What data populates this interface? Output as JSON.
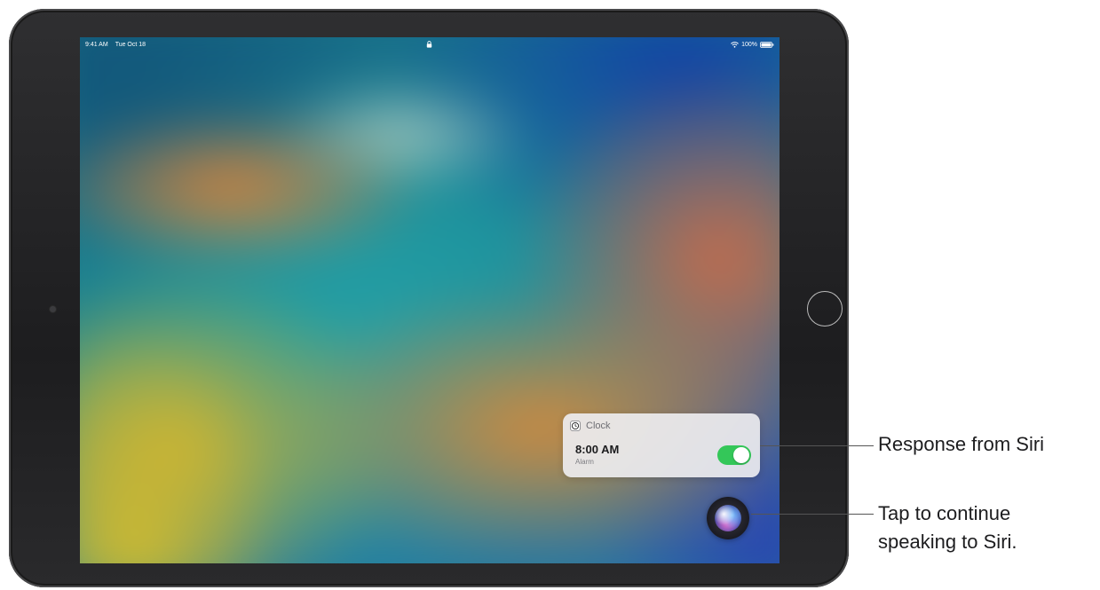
{
  "status_bar": {
    "time": "9:41 AM",
    "date": "Tue Oct 18",
    "battery": "100%"
  },
  "siri_response": {
    "app_name": "Clock",
    "alarm_time": "8:00 AM",
    "alarm_label": "Alarm",
    "toggle_on": true
  },
  "callouts": {
    "response": "Response from Siri",
    "tap_line1": "Tap to continue",
    "tap_line2": "speaking to Siri."
  },
  "colors": {
    "toggle_on": "#34c759",
    "device_frame": "#1d1d1f"
  },
  "icons": [
    "lock-icon",
    "wifi-icon",
    "battery-icon",
    "clock-icon",
    "siri-icon",
    "home-button"
  ]
}
